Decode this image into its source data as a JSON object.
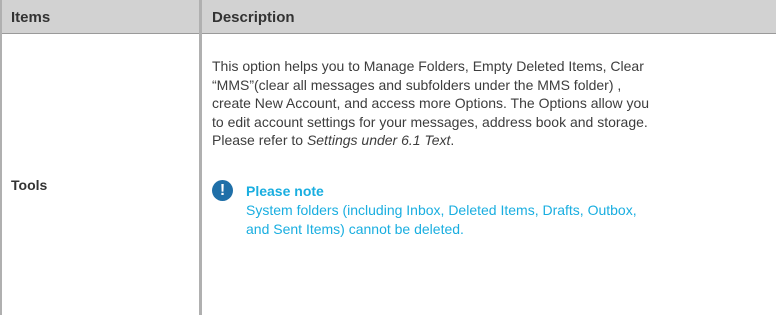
{
  "table": {
    "headers": {
      "items": "Items",
      "description": "Description"
    },
    "row": {
      "item": "Tools",
      "description_lines": [
        "This option helps you to Manage Folders, Empty Deleted Items, Clear",
        "“MMS”(clear all messages and subfolders under the MMS folder) ,",
        "create New Account, and access more Options. The Options allow you",
        "to edit account settings for your messages, address book and storage."
      ],
      "refer_prefix": "Please refer to ",
      "refer_italic": "Settings under 6.1 Text",
      "refer_suffix": ".",
      "note": {
        "icon": "exclamation-icon",
        "icon_glyph": "!",
        "title": "Please note",
        "body_lines": [
          "System folders (including Inbox, Deleted Items, Drafts, Outbox,",
          "and Sent Items) cannot be deleted."
        ]
      }
    }
  },
  "colors": {
    "header_bg": "#d2d2d2",
    "border": "#b0b0b0",
    "note_text": "#19aee0",
    "note_icon": "#1f6fa8"
  }
}
